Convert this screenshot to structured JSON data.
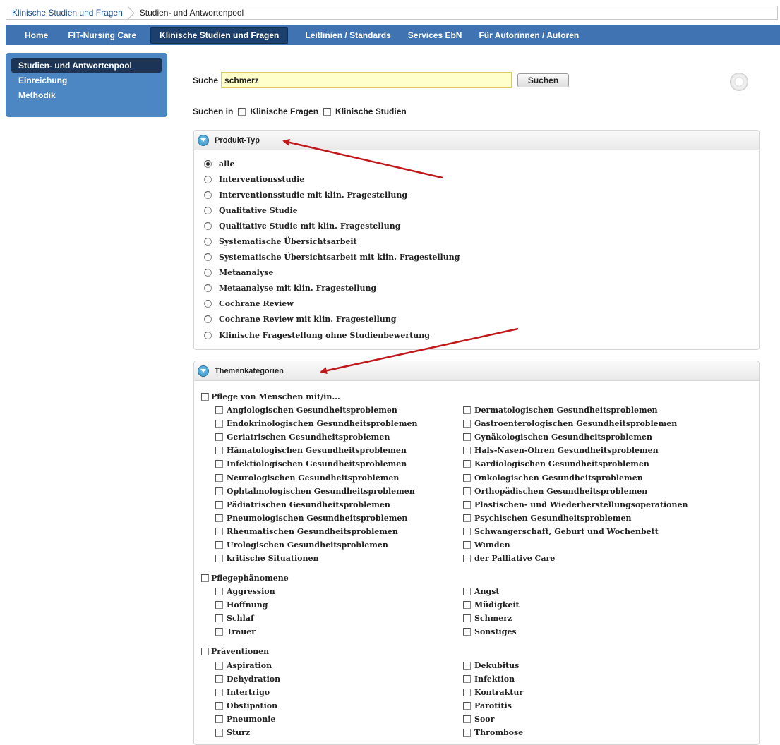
{
  "breadcrumb": {
    "items": [
      "Klinische Studien und Fragen",
      "Studien- und Antwortenpool"
    ]
  },
  "nav": {
    "items": [
      "Home",
      "FIT-Nursing Care",
      "Klinische Studien und Fragen",
      "Leitlinien / Standards",
      "Services EbN",
      "Für Autorinnen / Autoren"
    ],
    "active": "Klinische Studien und Fragen"
  },
  "sidebar": {
    "items": [
      "Studien- und Antwortenpool",
      "Einreichung",
      "Methodik"
    ],
    "active": "Studien- und Antwortenpool"
  },
  "search": {
    "label": "Suche",
    "value": "schmerz",
    "button": "Suchen"
  },
  "search_in": {
    "label": "Suchen in",
    "options": [
      "Klinische Fragen",
      "Klinische Studien"
    ]
  },
  "produkt_typ": {
    "title": "Produkt-Typ",
    "options": [
      "alle",
      "Interventionsstudie",
      "Interventionsstudie mit klin. Fragestellung",
      "Qualitative Studie",
      "Qualitative Studie mit klin. Fragestellung",
      "Systematische Übersichtsarbeit",
      "Systematische Übersichtsarbeit mit klin. Fragestellung",
      "Metaanalyse",
      "Metaanalyse mit klin. Fragestellung",
      "Cochrane Review",
      "Cochrane Review mit klin. Fragestellung",
      "Klinische Fragestellung ohne Studienbewertung"
    ],
    "selected": "alle"
  },
  "themenkategorien": {
    "title": "Themenkategorien",
    "groups": [
      {
        "label": "Pflege von Menschen mit/in...",
        "left": [
          "Angiologischen Gesundheitsproblemen",
          "Endokrinologischen Gesundheitsproblemen",
          "Geriatrischen Gesundheitsproblemen",
          "Hämatologischen Gesundheitsproblemen",
          "Infektiologischen Gesundheitsproblemen",
          "Neurologischen Gesundheitsproblemen",
          "Ophtalmologischen Gesundheitsproblemen",
          "Pädiatrischen Gesundheitsproblemen",
          "Pneumologischen Gesundheitsproblemen",
          "Rheumatischen Gesundheitsproblemen",
          "Urologischen Gesundheitsproblemen",
          "kritische Situationen"
        ],
        "right": [
          "Dermatologischen Gesundheitsproblemen",
          "Gastroenterologischen Gesundheitsproblemen",
          "Gynäkologischen Gesundheitsproblemen",
          "Hals-Nasen-Ohren Gesundheitsproblemen",
          "Kardiologischen Gesundheitsproblemen",
          "Onkologischen Gesundheitsproblemen",
          "Orthopädischen Gesundheitsproblemen",
          "Plastischen- und Wiederherstellungsoperationen",
          "Psychischen Gesundheitsproblemen",
          "Schwangerschaft, Geburt und Wochenbett",
          "Wunden",
          "der Palliative Care"
        ]
      },
      {
        "label": "Pflegephänomene",
        "left": [
          "Aggression",
          "Hoffnung",
          "Schlaf",
          "Trauer"
        ],
        "right": [
          "Angst",
          "Müdigkeit",
          "Schmerz",
          "Sonstiges"
        ]
      },
      {
        "label": "Präventionen",
        "left": [
          "Aspiration",
          "Dehydration",
          "Intertrigo",
          "Obstipation",
          "Pneumonie",
          "Sturz"
        ],
        "right": [
          "Dekubitus",
          "Infektion",
          "Kontraktur",
          "Parotitis",
          "Soor",
          "Thrombose"
        ]
      }
    ]
  },
  "colors": {
    "nav_bg": "#3f73b1",
    "nav_active": "#1d3f6b",
    "sidebar_bg": "#4c86c3",
    "sidebar_active": "#1c3556",
    "search_bg": "#ffffcc",
    "arrow": "#c0181b"
  }
}
